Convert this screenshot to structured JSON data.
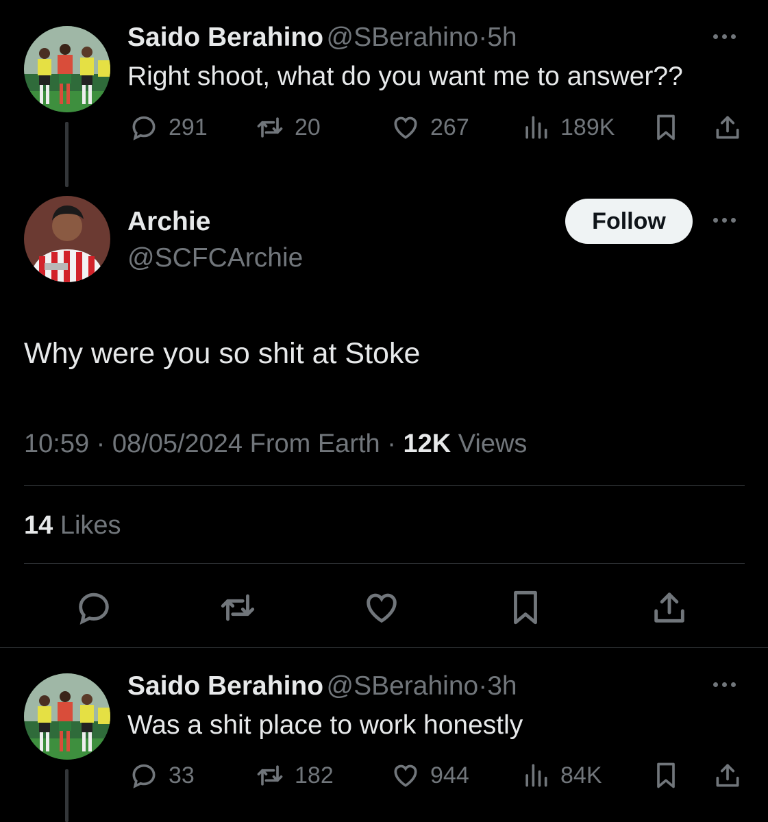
{
  "tweet1": {
    "name": "Saido Berahino",
    "handle": "@SBerahino",
    "sep": "·",
    "time": "5h",
    "text": "Right shoot, what do you want me to answer??",
    "replies": "291",
    "retweets": "20",
    "likes": "267",
    "views": "189K"
  },
  "main_tweet": {
    "name": "Archie",
    "handle": "@SCFCArchie",
    "follow_label": "Follow",
    "text": "Why were you so shit at Stoke",
    "time": "10:59",
    "date": "08/05/2024",
    "source": "From Earth",
    "sep": "·",
    "views_count": "12K",
    "views_label": "Views",
    "likes_count": "14",
    "likes_label": "Likes"
  },
  "tweet2": {
    "name": "Saido Berahino",
    "handle": "@SBerahino",
    "sep": "·",
    "time": "3h",
    "text": "Was a shit place to work honestly",
    "replies": "33",
    "retweets": "182",
    "likes": "944",
    "views": "84K"
  },
  "icons": {
    "reply": "reply-icon",
    "retweet": "retweet-icon",
    "like": "heart-icon",
    "views": "views-icon",
    "bookmark": "bookmark-icon",
    "share": "share-icon",
    "more": "more-icon"
  },
  "colors": {
    "background": "#000000",
    "text": "#e7e9ea",
    "muted": "#71767b",
    "follow_bg": "#eff3f4"
  }
}
